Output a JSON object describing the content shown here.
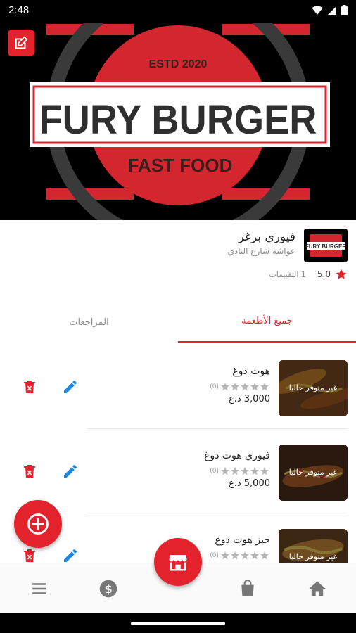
{
  "status_bar": {
    "time": "2:48",
    "icons": [
      "wifi-icon",
      "signal-icon",
      "battery-icon"
    ]
  },
  "banner": {
    "brand_top": "ESTD 2020",
    "brand_name": "FURY BURGER",
    "brand_sub": "FAST FOOD",
    "edit_icon": "edit-square-icon"
  },
  "restaurant": {
    "name": "فيوري برغر",
    "address": "عواشة شارع النادي",
    "logo_text": "FURY BURGER",
    "rating": "5.0",
    "ratings_count": "1 التقييمات"
  },
  "tabs": {
    "all_foods": "جميع الأطعمة",
    "reviews": "المراجعات"
  },
  "foods": [
    {
      "name": "هوت دوغ",
      "reviews": "(0)",
      "price": "3,000 د.ع",
      "overlay": "غير متوفر حاليا",
      "color": "#7a4b24"
    },
    {
      "name": "فيوري هوت دوغ",
      "reviews": "(0)",
      "price": "5,000 د.ع",
      "overlay": "غير متوفر حاليا",
      "color": "#4b2e1a"
    },
    {
      "name": "جيز هوت دوغ",
      "reviews": "(0)",
      "price": "",
      "overlay": "غير متوفر حاليا",
      "color": "#6b4524"
    }
  ],
  "colors": {
    "accent": "#e3222b",
    "muted": "#8a8a8a"
  },
  "bottom_nav": [
    "menu-icon",
    "dollar-icon",
    "store-icon",
    "shopping-bag-icon",
    "home-icon"
  ]
}
